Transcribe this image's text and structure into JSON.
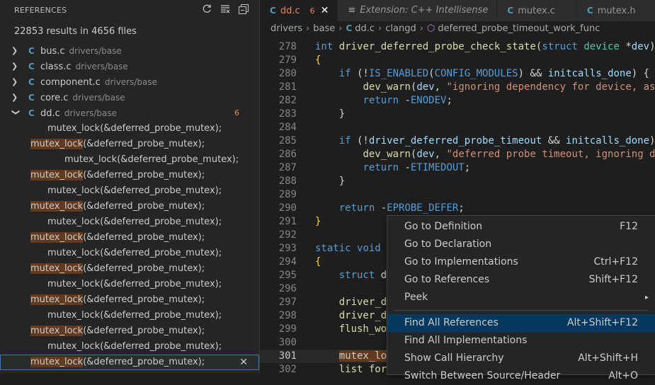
{
  "sidebar": {
    "title": "REFERENCES",
    "summary": "22853 results in 4656 files",
    "files": [
      {
        "icon": "C",
        "name": "bus.c",
        "path": "drivers/base",
        "expanded": false
      },
      {
        "icon": "C",
        "name": "class.c",
        "path": "drivers/base",
        "expanded": false
      },
      {
        "icon": "C",
        "name": "component.c",
        "path": "drivers/base",
        "expanded": false
      },
      {
        "icon": "C",
        "name": "core.c",
        "path": "drivers/base",
        "expanded": false
      },
      {
        "icon": "C",
        "name": "dd.c",
        "path": "drivers/base",
        "expanded": true,
        "count": "6"
      }
    ],
    "matches": [
      {
        "pre": "",
        "hl": "",
        "text": "mutex_lock(&deferred_probe_mutex);"
      },
      {
        "pre": "",
        "hl": "mutex_lock",
        "text": "(&deferred_probe_mutex);"
      },
      {
        "pre": "",
        "hl": "",
        "text": "mutex_lock(&deferred_probe_mutex);"
      },
      {
        "pre": "",
        "hl": "mutex_lock",
        "text": "(&deferred_probe_mutex);"
      },
      {
        "pre": "",
        "hl": "",
        "text": "mutex_lock(&deferred_probe_mutex);"
      },
      {
        "pre": "",
        "hl": "mutex_lock",
        "text": "(&deferred_probe_mutex);"
      },
      {
        "pre": "",
        "hl": "",
        "text": "mutex_lock(&deferred_probe_mutex);"
      },
      {
        "pre": "",
        "hl": "mutex_lock",
        "text": "(&deferred_probe_mutex);"
      },
      {
        "pre": "",
        "hl": "",
        "text": "mutex_lock(&deferred_probe_mutex);"
      },
      {
        "pre": "",
        "hl": "mutex_lock",
        "text": "(&deferred_probe_mutex);"
      },
      {
        "pre": "",
        "hl": "",
        "text": "mutex_lock(&deferred_probe_mutex);"
      },
      {
        "pre": "",
        "hl": "mutex_lock",
        "text": "(&deferred_probe_mutex);"
      },
      {
        "pre": "",
        "hl": "",
        "text": "mutex_lock(&deferred_probe_mutex);"
      },
      {
        "pre": "",
        "hl": "mutex_lock",
        "text": "(&deferred_probe_mutex);"
      },
      {
        "pre": "",
        "hl": "",
        "text": "mutex_lock(&deferred_probe_mutex);"
      },
      {
        "pre": "",
        "hl": "mutex_lock",
        "text": "(&deferred_probe_mutex);"
      }
    ],
    "close_glyph": "✕"
  },
  "tabs": [
    {
      "icon": "C",
      "label": "dd.c",
      "count": "6",
      "close": "✕",
      "active": true
    },
    {
      "icon": "≡",
      "label": "Extension: C++ Intellisense",
      "italic": true
    },
    {
      "icon": "C",
      "label": "mutex.c"
    },
    {
      "icon": "C",
      "label": "mutex.h"
    }
  ],
  "breadcrumb": {
    "items": [
      "drivers",
      "base",
      "dd.c",
      "clangd",
      "deferred_probe_timeout_work_func"
    ],
    "sep": "›",
    "c_icon": "C",
    "sym_icon": "⬡"
  },
  "code": [
    {
      "n": "278",
      "tokens": [
        [
          "kw",
          "int"
        ],
        [
          "op",
          " "
        ],
        [
          "fn",
          "driver_deferred_probe_check_state"
        ],
        [
          "op",
          "("
        ],
        [
          "kw",
          "struct"
        ],
        [
          "op",
          " "
        ],
        [
          "ty",
          "device"
        ],
        [
          "op",
          " *"
        ],
        [
          "var",
          "dev"
        ],
        [
          "op",
          ")"
        ]
      ]
    },
    {
      "n": "279",
      "tokens": [
        [
          "br",
          "{"
        ]
      ]
    },
    {
      "n": "280",
      "tokens": [
        [
          "op",
          "    "
        ],
        [
          "kw",
          "if"
        ],
        [
          "op",
          " (!"
        ],
        [
          "mac",
          "IS_ENABLED"
        ],
        [
          "op",
          "("
        ],
        [
          "mac",
          "CONFIG_MODULES"
        ],
        [
          "op",
          ") && "
        ],
        [
          "var",
          "initcalls_done"
        ],
        [
          "op",
          ") {"
        ]
      ]
    },
    {
      "n": "281",
      "tokens": [
        [
          "op",
          "        "
        ],
        [
          "fn",
          "dev_warn"
        ],
        [
          "op",
          "("
        ],
        [
          "var",
          "dev"
        ],
        [
          "op",
          ", "
        ],
        [
          "str",
          "\"ignoring dependency for device, assu"
        ]
      ]
    },
    {
      "n": "282",
      "tokens": [
        [
          "op",
          "        "
        ],
        [
          "kw",
          "return"
        ],
        [
          "op",
          " -"
        ],
        [
          "mac",
          "ENODEV"
        ],
        [
          "op",
          ";"
        ]
      ]
    },
    {
      "n": "283",
      "tokens": [
        [
          "op",
          "    }"
        ]
      ]
    },
    {
      "n": "284",
      "tokens": []
    },
    {
      "n": "285",
      "tokens": [
        [
          "op",
          "    "
        ],
        [
          "kw",
          "if"
        ],
        [
          "op",
          " (!"
        ],
        [
          "var",
          "driver_deferred_probe_timeout"
        ],
        [
          "op",
          " && "
        ],
        [
          "var",
          "initcalls_done"
        ],
        [
          "op",
          ")"
        ]
      ]
    },
    {
      "n": "286",
      "tokens": [
        [
          "op",
          "        "
        ],
        [
          "fn",
          "dev_warn"
        ],
        [
          "op",
          "("
        ],
        [
          "var",
          "dev"
        ],
        [
          "op",
          ", "
        ],
        [
          "str",
          "\"deferred probe timeout, ignoring de"
        ]
      ]
    },
    {
      "n": "287",
      "tokens": [
        [
          "op",
          "        "
        ],
        [
          "kw",
          "return"
        ],
        [
          "op",
          " -"
        ],
        [
          "mac",
          "ETIMEDOUT"
        ],
        [
          "op",
          ";"
        ]
      ]
    },
    {
      "n": "288",
      "tokens": [
        [
          "op",
          "    }"
        ]
      ]
    },
    {
      "n": "289",
      "tokens": []
    },
    {
      "n": "290",
      "tokens": [
        [
          "op",
          "    "
        ],
        [
          "kw",
          "return"
        ],
        [
          "op",
          " -"
        ],
        [
          "mac",
          "EPROBE_DEFER"
        ],
        [
          "op",
          ";"
        ]
      ]
    },
    {
      "n": "291",
      "tokens": [
        [
          "br",
          "}"
        ]
      ]
    },
    {
      "n": "292",
      "tokens": []
    },
    {
      "n": "293",
      "tokens": [
        [
          "kw",
          "static"
        ],
        [
          "op",
          " "
        ],
        [
          "kw",
          "void"
        ],
        [
          "op",
          " "
        ]
      ]
    },
    {
      "n": "294",
      "tokens": [
        [
          "br",
          "{"
        ]
      ]
    },
    {
      "n": "295",
      "tokens": [
        [
          "op",
          "    "
        ],
        [
          "kw",
          "struct"
        ],
        [
          "op",
          " d"
        ]
      ]
    },
    {
      "n": "296",
      "tokens": []
    },
    {
      "n": "297",
      "tokens": [
        [
          "op",
          "    "
        ],
        [
          "fn",
          "driver_d"
        ]
      ]
    },
    {
      "n": "298",
      "tokens": [
        [
          "op",
          "    "
        ],
        [
          "fn",
          "driver_d"
        ]
      ]
    },
    {
      "n": "299",
      "tokens": [
        [
          "op",
          "    "
        ],
        [
          "fn",
          "flush_wo"
        ]
      ]
    },
    {
      "n": "300",
      "tokens": []
    },
    {
      "n": "301",
      "tokens": [
        [
          "op",
          "    "
        ],
        [
          "hlw",
          "mutex_loc"
        ]
      ],
      "current": true
    },
    {
      "n": "302",
      "tokens": [
        [
          "op",
          "    "
        ],
        [
          "fn",
          "list_for"
        ]
      ]
    }
  ],
  "context_menu": {
    "groups": [
      [
        {
          "label": "Go to Definition",
          "key": "F12"
        },
        {
          "label": "Go to Declaration",
          "key": ""
        },
        {
          "label": "Go to Implementations",
          "key": "Ctrl+F12"
        },
        {
          "label": "Go to References",
          "key": "Shift+F12"
        },
        {
          "label": "Peek",
          "key": "",
          "submenu": true
        }
      ],
      [
        {
          "label": "Find All References",
          "key": "Alt+Shift+F12",
          "active": true
        },
        {
          "label": "Find All Implementations",
          "key": ""
        },
        {
          "label": "Show Call Hierarchy",
          "key": "Alt+Shift+H"
        },
        {
          "label": "Switch Between Source/Header",
          "key": "Alt+O"
        }
      ]
    ],
    "submenu_arrow": "▸"
  }
}
